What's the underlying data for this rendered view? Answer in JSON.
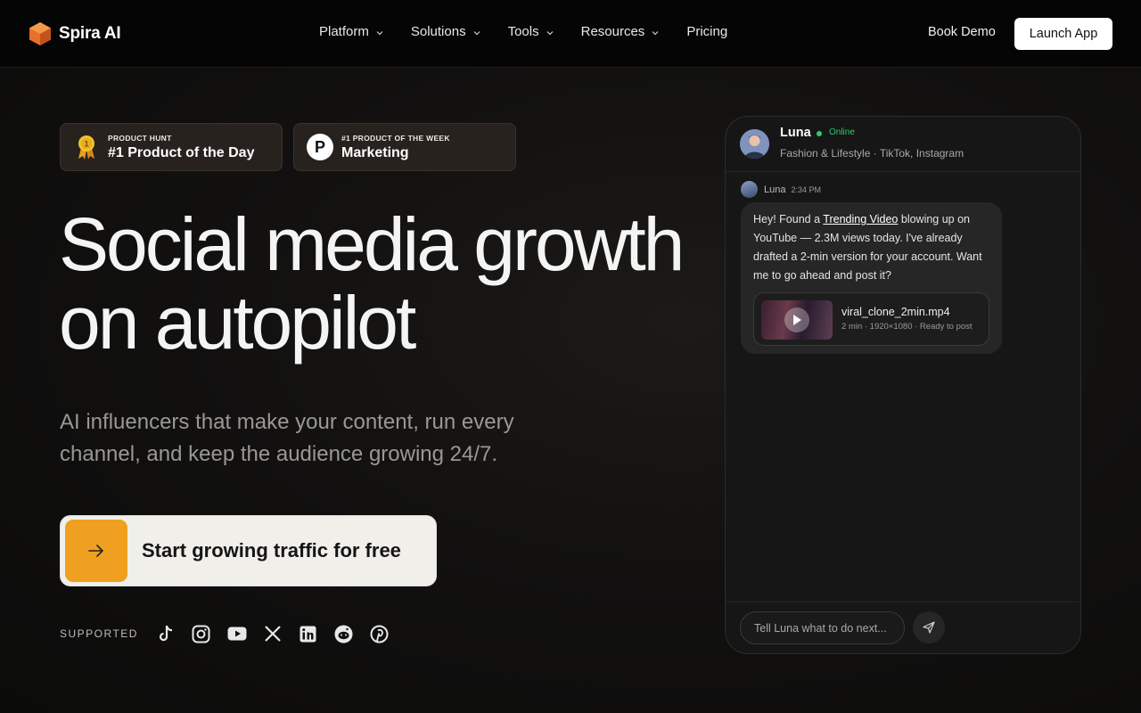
{
  "nav": {
    "brand": "Spira AI",
    "links": [
      "Platform",
      "Solutions",
      "Tools",
      "Resources",
      "Pricing"
    ],
    "book_demo": "Book Demo",
    "launch_app": "Launch App"
  },
  "badges": [
    {
      "eyebrow": "PRODUCT HUNT",
      "title": "#1 Product of the Day",
      "icon": "medal-icon"
    },
    {
      "eyebrow": "#1 PRODUCT OF THE WEEK",
      "title": "Marketing",
      "icon": "producthunt-icon",
      "icon_letter": "P"
    }
  ],
  "hero": {
    "title_line1": "Social media growth",
    "title_line2": "on autopilot",
    "subtitle": "AI influencers that make your content, run every channel, and keep the audience growing 24/7.",
    "cta": "Start growing traffic for free"
  },
  "supported": {
    "label": "SUPPORTED",
    "platforms": [
      "tiktok-icon",
      "instagram-icon",
      "youtube-icon",
      "x-icon",
      "linkedin-icon",
      "reddit-icon",
      "pinterest-icon"
    ]
  },
  "chat": {
    "name": "Luna",
    "status": "Online",
    "meta": "Fashion & Lifestyle · TikTok, Instagram",
    "message": {
      "author": "Luna",
      "time": "2:34 PM",
      "text_before": "Hey! Found a ",
      "link": "Trending Video",
      "text_after": " blowing up on YouTube — 2.3M views today. I've already drafted a 2-min version for your account. Want me to go ahead and post it?",
      "attachment": {
        "file": "viral_clone_2min.mp4",
        "meta": "2 min · 1920×1080 · Ready to post"
      }
    },
    "input_placeholder": "Tell Luna what to do next..."
  },
  "colors": {
    "accent": "#f0a020",
    "online": "#2ec96a",
    "logo": "#e8702a"
  }
}
